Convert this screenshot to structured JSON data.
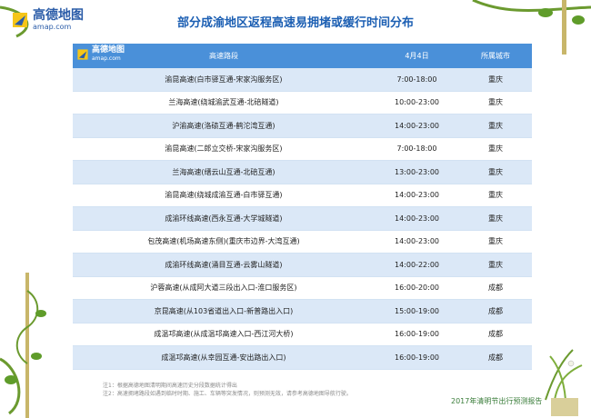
{
  "header": {
    "logo_cn": "高德地图",
    "logo_en": "amap.com",
    "title": "部分成渝地区返程高速易拥堵或缓行时间分布"
  },
  "table": {
    "logo_cn": "高德地图",
    "logo_en": "amap.com",
    "columns": [
      "高速路段",
      "4月4日",
      "所属城市"
    ],
    "rows": [
      {
        "route": "渝昆高速(白市驿互通-宋家沟服务区)",
        "time": "7:00-18:00",
        "city": "重庆"
      },
      {
        "route": "兰海高速(绕城渝武互通-北碚隧道)",
        "time": "10:00-23:00",
        "city": "重庆"
      },
      {
        "route": "沪渝高速(洛碛互通-鹤沱湾互通)",
        "time": "14:00-23:00",
        "city": "重庆"
      },
      {
        "route": "渝昆高速(二郎立交桥-宋家沟服务区)",
        "time": "7:00-18:00",
        "city": "重庆"
      },
      {
        "route": "兰海高速(缙云山互通-北碚互通)",
        "time": "13:00-23:00",
        "city": "重庆"
      },
      {
        "route": "渝昆高速(绕城成渝互通-白市驿互通)",
        "time": "14:00-23:00",
        "city": "重庆"
      },
      {
        "route": "成渝环线高速(西永互通-大学城隧道)",
        "time": "14:00-23:00",
        "city": "重庆"
      },
      {
        "route": "包茂高速(机场高速东侧)(重庆市边界-大湾互通)",
        "time": "14:00-23:00",
        "city": "重庆"
      },
      {
        "route": "成渝环线高速(涌目互通-云雾山隧道)",
        "time": "14:00-22:00",
        "city": "重庆"
      },
      {
        "route": "沪蓉高速(从成阿大道三段出入口-淮口服务区)",
        "time": "16:00-20:00",
        "city": "成都"
      },
      {
        "route": "京昆高速(从103省道出入口-新普路出入口)",
        "time": "15:00-19:00",
        "city": "成都"
      },
      {
        "route": "成温邛高速(从成温邛高速入口-西江河大桥)",
        "time": "16:00-19:00",
        "city": "成都"
      },
      {
        "route": "成温邛高速(从幸园互通-安出路出入口)",
        "time": "16:00-19:00",
        "city": "成都"
      }
    ]
  },
  "notes": [
    "注1：根据高德地图清明期间高速历史分段数据统计得出",
    "注2：高速拥堵路段如遇到临时时期、施工、车辆等突发情况，则预测无效，请参考高德地图导航行驶。"
  ],
  "footer": {
    "report_title": "2017年清明节出行预测报告"
  },
  "colors": {
    "header_blue": "#4a90d9",
    "row_stripe": "#dbe8f7",
    "title_blue": "#1c5fb3",
    "report_green": "#3a7d3a"
  }
}
